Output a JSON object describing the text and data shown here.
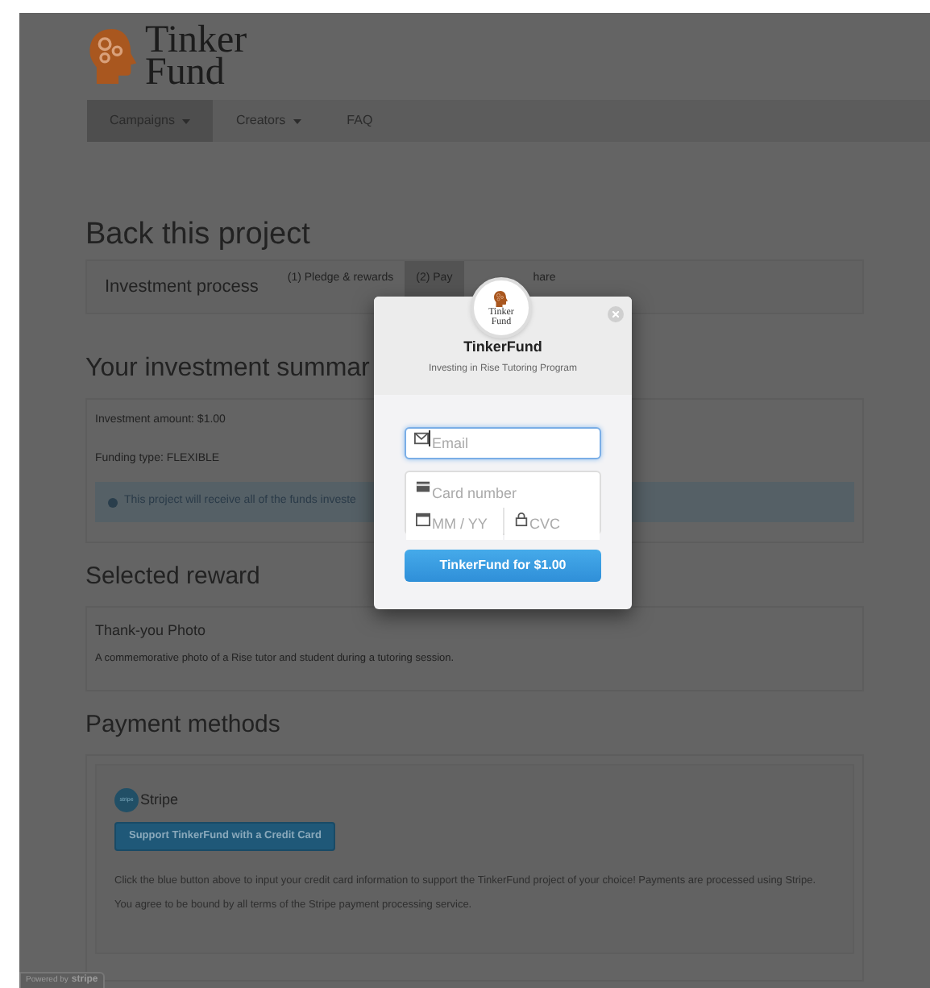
{
  "site": {
    "logo_lines": [
      "Tinker",
      "Fund"
    ]
  },
  "nav": [
    {
      "label": "Campaigns",
      "dropdown": true,
      "selected": true
    },
    {
      "label": "Creators",
      "dropdown": true,
      "selected": false
    },
    {
      "label": "FAQ",
      "dropdown": false,
      "selected": false
    }
  ],
  "page_title": "Back this project",
  "process": {
    "label": "Investment process",
    "steps": [
      {
        "label": "(1) Pledge & rewards",
        "selected": false
      },
      {
        "label": "(2) Pay",
        "selected": true
      },
      {
        "label": "hare",
        "selected": false
      }
    ]
  },
  "summary": {
    "heading": "Your investment summar",
    "lines": [
      "Investment amount: $1.00",
      "Funding type: FLEXIBLE"
    ],
    "notice": "This project will receive all of the funds investe"
  },
  "reward": {
    "heading": "Selected reward",
    "title": "Thank-you Photo",
    "description": "A commemorative photo of a Rise tutor and student during a tutoring session."
  },
  "payment": {
    "heading": "Payment methods",
    "provider_badge": "stripe",
    "provider": "Stripe",
    "button": "Support TinkerFund with a Credit Card",
    "note": "Click the blue button above to input your credit card information to support the TinkerFund project of your choice! Payments are processed using Stripe. You agree to be bound by all terms of the Stripe payment processing service."
  },
  "powered_by": {
    "prefix": "Powered by",
    "brand": "stripe"
  },
  "modal": {
    "logo_lines": [
      "Tinker",
      "Fund"
    ],
    "title": "TinkerFund",
    "subtitle": "Investing in Rise Tutoring Program",
    "fields": [
      {
        "kind": "email",
        "placeholder": "Email",
        "focused": true
      },
      {
        "kind": "card",
        "placeholder": "Card number",
        "focused": false
      },
      {
        "kind": "expiry",
        "placeholder": "MM / YY",
        "focused": false
      },
      {
        "kind": "cvc",
        "placeholder": "CVC",
        "focused": false
      }
    ],
    "submit": "TinkerFund for $1.00"
  }
}
